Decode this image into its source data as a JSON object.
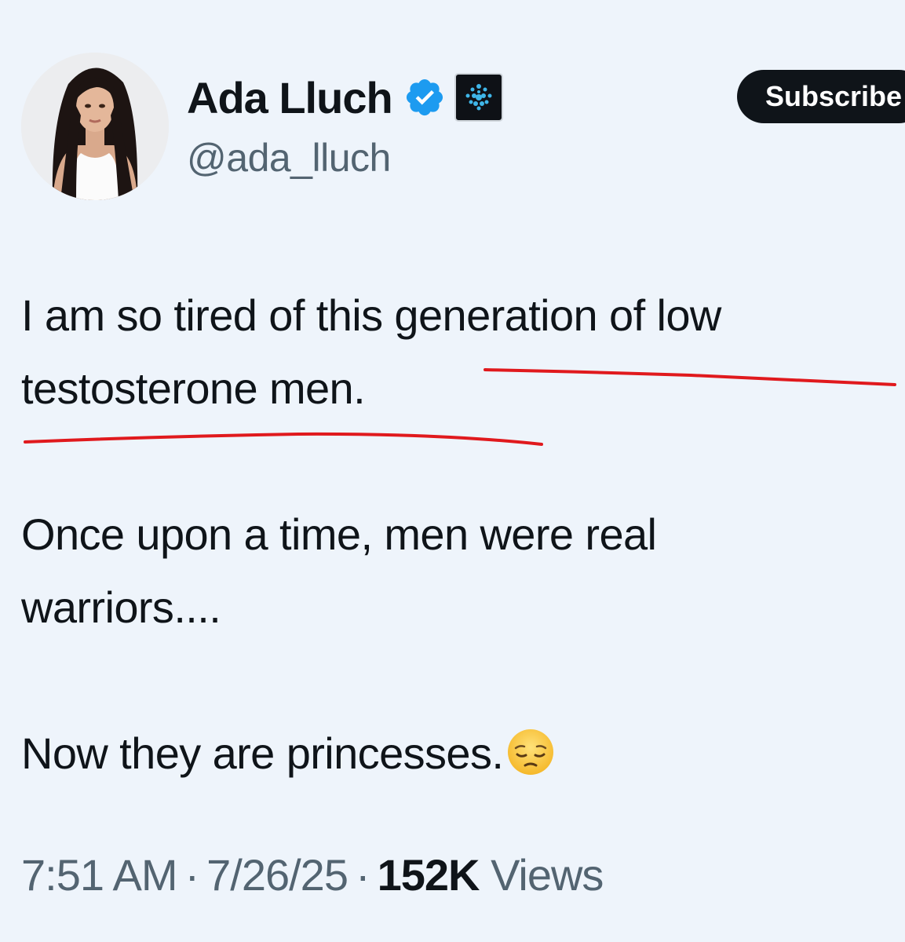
{
  "author": {
    "display_name": "Ada Lluch",
    "handle": "@ada_lluch",
    "verified": true
  },
  "subscribe_label": "Subscribe",
  "tweet": {
    "paragraphs": [
      "I am so tired of this generation of low\ntestosterone men.",
      "Once upon a time, men were real\nwarriors....",
      "Now they are princesses."
    ],
    "emoji": "pensive-face"
  },
  "meta": {
    "time": "7:51 AM",
    "separator": "·",
    "date": "7/26/25",
    "views_count": "152K",
    "views_label": "Views"
  },
  "colors": {
    "background": "#eef4fb",
    "text": "#0f1419",
    "secondary": "#536471",
    "verified": "#1d9bf0",
    "annotation_red": "#e0191d"
  }
}
